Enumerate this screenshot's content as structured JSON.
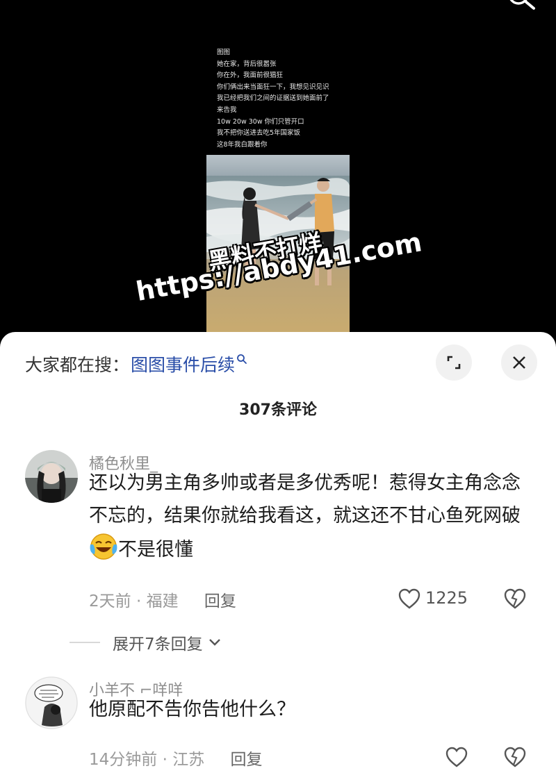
{
  "video": {
    "post_lines": "图图\n她在家，背后很嚣张\n你在外，我面前很猖狂\n你们俩出来当面狂一下，我想见识见识\n我已经把我们之间的证据送到她面前了\n来告我\n10w 20w 30w 你们只管开口\n我不把你送进去吃5年国家饭\n这8年我白跟着你",
    "watermark_line1": "黑料不打烊",
    "watermark_line2": "https://abdy41.com"
  },
  "sheet": {
    "search_prefix": "大家都在搜：",
    "search_link": "图图事件后续",
    "comments_count": "307条评论"
  },
  "comments": [
    {
      "username": "橘色秋里_",
      "text_part1": "还以为男主角多帅或者是多优秀呢！惹得女主角念念不忘的，结果你就给我看这，就这还不甘心鱼死网破",
      "text_part2": "不是很懂",
      "emoji": "crying-laughing-emoji",
      "time": "2天前 · 福建",
      "reply": "回复",
      "likes": "1225",
      "expand": "展开7条回复"
    },
    {
      "username": "小羊不 ⌐咩咩",
      "text_part1": "他原配不告你告他什么？",
      "time": "14分钟前 · 江苏",
      "reply": "回复"
    }
  ],
  "colors": {
    "link": "#2a4ea8",
    "sheet_bg": "#ffffff",
    "video_bg": "#000000"
  }
}
